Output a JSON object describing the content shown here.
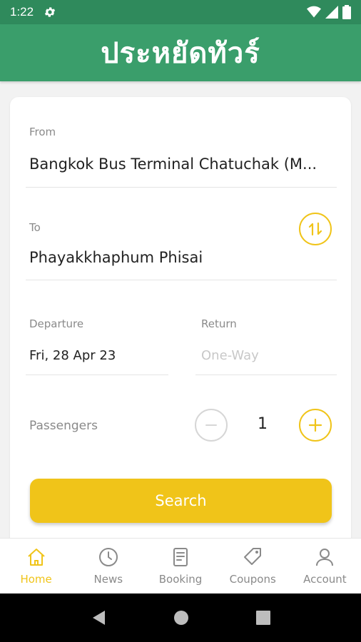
{
  "status_bar": {
    "time": "1:22"
  },
  "app_bar": {
    "title": "ประหยัดทัวร์"
  },
  "form": {
    "from_label": "From",
    "from_value": "Bangkok Bus Terminal Chatuchak (M...",
    "to_label": "To",
    "to_value": "Phayakkhaphum Phisai",
    "departure_label": "Departure",
    "departure_value": "Fri, 28 Apr 23",
    "return_label": "Return",
    "return_placeholder": "One-Way",
    "passengers_label": "Passengers",
    "passengers_count": "1",
    "search_label": "Search"
  },
  "bottom_nav": [
    {
      "label": "Home",
      "icon": "home-icon",
      "active": true
    },
    {
      "label": "News",
      "icon": "clock-icon",
      "active": false
    },
    {
      "label": "Booking",
      "icon": "booking-icon",
      "active": false
    },
    {
      "label": "Coupons",
      "icon": "tag-icon",
      "active": false
    },
    {
      "label": "Account",
      "icon": "person-icon",
      "active": false
    }
  ],
  "colors": {
    "primary_green": "#3a9e6b",
    "status_green": "#2f8a5c",
    "accent_yellow": "#f0c419"
  }
}
